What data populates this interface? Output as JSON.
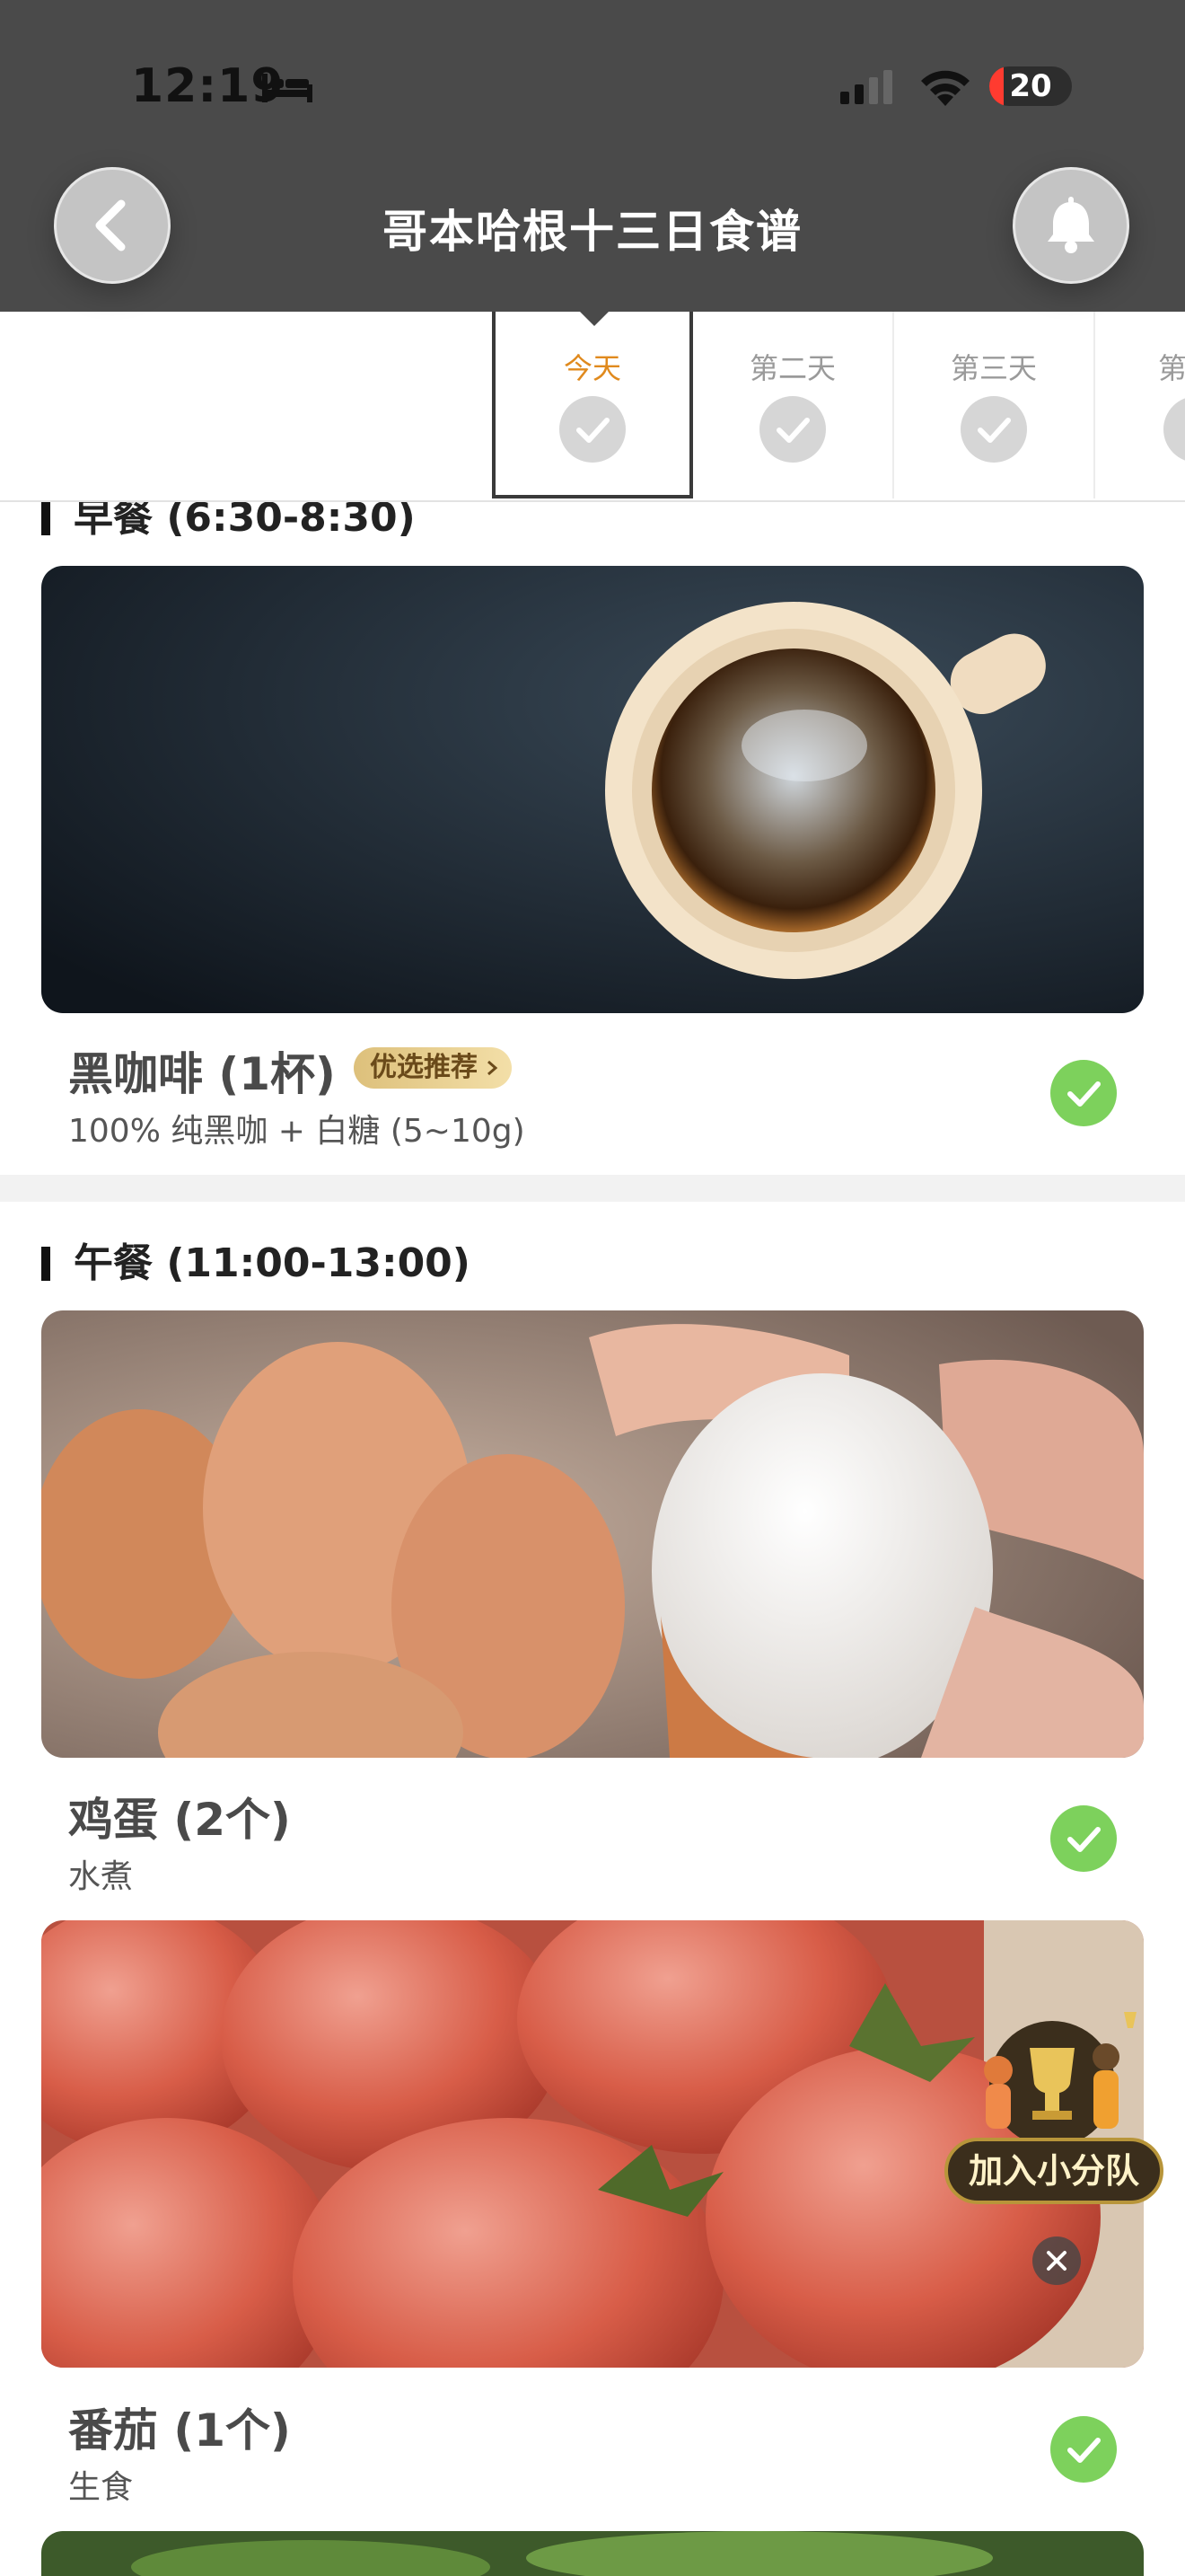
{
  "status_bar": {
    "time": "12:19",
    "battery": "20"
  },
  "header": {
    "title": "哥本哈根十三日食谱"
  },
  "tabs": [
    {
      "label": "今天",
      "active": true
    },
    {
      "label": "第二天",
      "active": false
    },
    {
      "label": "第三天",
      "active": false
    },
    {
      "label": "第",
      "active": false
    }
  ],
  "breakfast": {
    "title": "早餐 (6:30-8:30)",
    "items": [
      {
        "name": "黑咖啡 (1杯)",
        "badge": "优选推荐",
        "desc": "100% 纯黑咖 + 白糖 (5~10g)",
        "done": true
      }
    ]
  },
  "lunch": {
    "title": "午餐 (11:00-13:00)",
    "items": [
      {
        "name": "鸡蛋 (2个)",
        "desc": "水煮",
        "done": true
      },
      {
        "name": "番茄 (1个)",
        "desc": "生食",
        "done": true
      }
    ]
  },
  "team_widget": {
    "label": "加入小分队"
  },
  "colors": {
    "header_bg": "#4a4a4a",
    "accent": "#e08a1e",
    "check_green": "#7dd15c"
  }
}
